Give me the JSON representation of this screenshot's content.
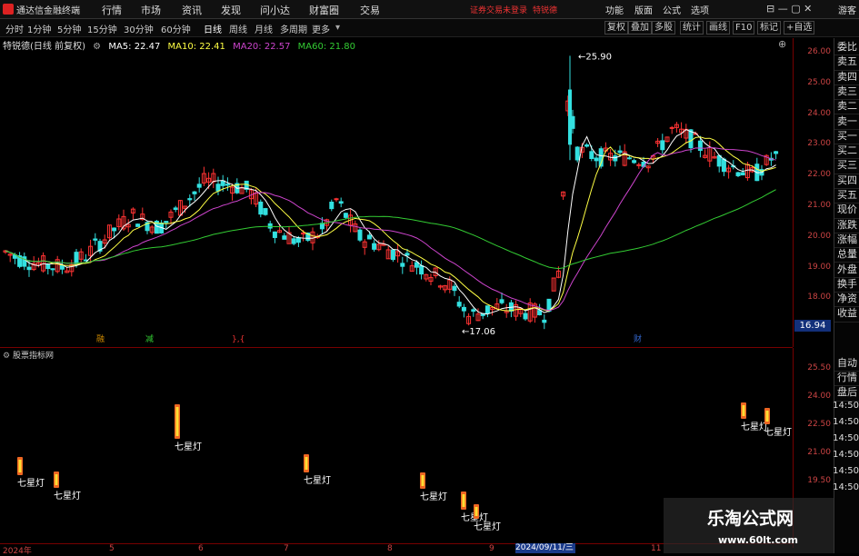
{
  "app": {
    "title": "通达信金融终端",
    "menus": [
      "行情",
      "市场",
      "资讯",
      "发现",
      "问小达",
      "财富圈",
      "交易"
    ],
    "notice": "证券交易未登录",
    "account": "特锐德",
    "right_menus": [
      "功能",
      "版面",
      "公式",
      "选项"
    ],
    "guest": "游客"
  },
  "toolbar": {
    "periods": [
      "分时",
      "1分钟",
      "5分钟",
      "15分钟",
      "30分钟",
      "60分钟",
      "日线",
      "周线",
      "月线",
      "多周期",
      "更多"
    ],
    "active_period": "日线",
    "right_buttons": [
      "复权",
      "叠加",
      "多股",
      "统计",
      "画线",
      "F10",
      "标记",
      "+自选"
    ]
  },
  "info": {
    "stock": "特锐德(日线 前复权)",
    "ma5": "MA5: 22.47",
    "ma10": "MA10: 22.41",
    "ma20": "MA20: 22.57",
    "ma60": "MA60: 21.80"
  },
  "colors": {
    "up": "#ff3333",
    "down": "#33e0e0",
    "ma5": "#ffffff",
    "ma10": "#ffff44",
    "ma20": "#cc44cc",
    "ma60": "#33cc33",
    "axis": "#cc3333"
  },
  "price_axis": {
    "ticks": [
      "26.00",
      "25.00",
      "24.00",
      "23.00",
      "22.00",
      "21.00",
      "20.00",
      "19.00",
      "18.00"
    ]
  },
  "annotations": {
    "high": "25.90",
    "low": "17.06"
  },
  "current_price": "16.94",
  "sidebar": [
    "委比",
    "卖五",
    "卖四",
    "卖三",
    "卖二",
    "卖一",
    "买一",
    "买二",
    "买三",
    "买四",
    "买五",
    "现价",
    "涨跌",
    "涨幅",
    "总量",
    "外盘",
    "换手",
    "净资",
    "收益",
    "自动",
    "行情",
    "盘后"
  ],
  "pane2": {
    "label": "股票指标网",
    "ticks": [
      "25.50",
      "24.00",
      "22.50",
      "21.00",
      "19.50"
    ],
    "right_times": [
      "14:50",
      "14:50",
      "14:50",
      "14:50",
      "14:50",
      "14:50"
    ],
    "signal_label": "七星灯"
  },
  "event_markers": [
    "融",
    "减",
    "},{",
    "财"
  ],
  "dates": [
    "2024年",
    "5",
    "6",
    "7",
    "8",
    "9",
    "2024/09/11/三",
    "11"
  ],
  "watermark": {
    "title": "乐淘公式网",
    "url": "www.60lt.com"
  }
}
